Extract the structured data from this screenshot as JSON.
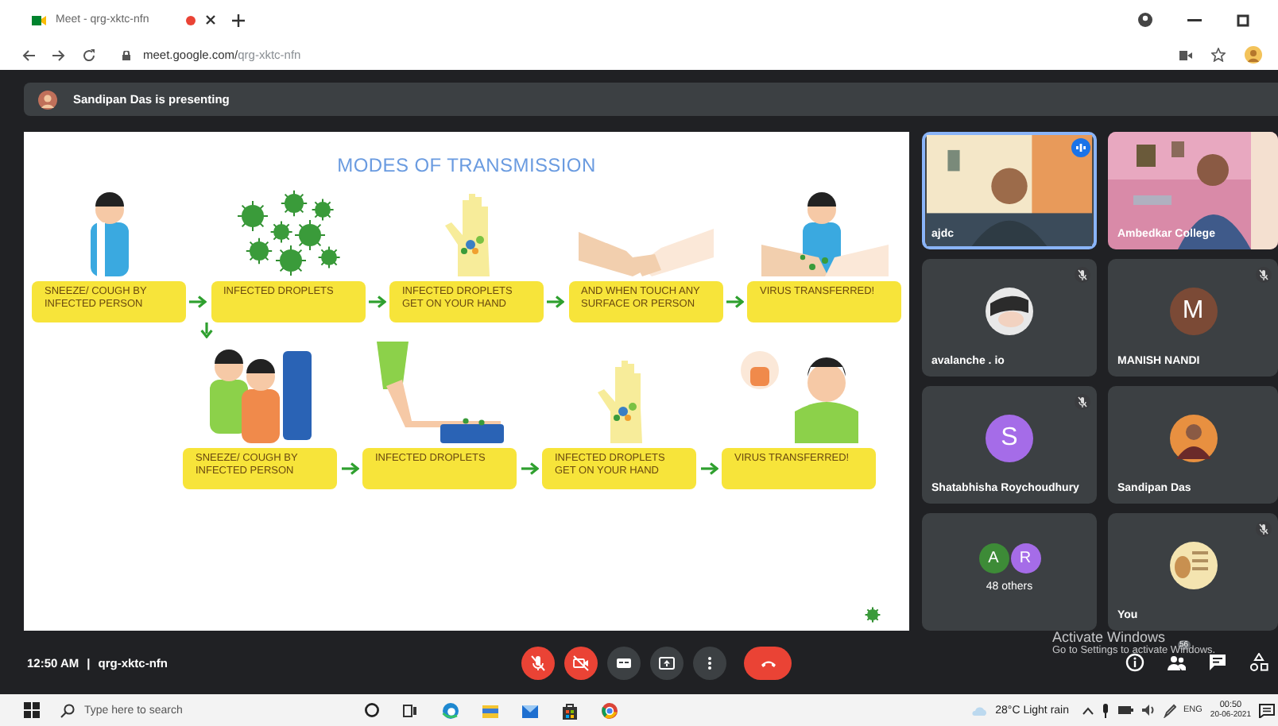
{
  "browser": {
    "tab_title": "Meet - qrg-xktc-nfn",
    "recording": true,
    "url_host": "meet.google.com/",
    "url_path": "qrg-xktc-nfn"
  },
  "presenting": {
    "text": "Sandipan Das is presenting"
  },
  "slide": {
    "title": "MODES OF TRANSMISSION",
    "rows": [
      {
        "steps": [
          {
            "kind": "sneezing-person",
            "label": "SNEEZE/ COUGH BY INFECTED PERSON"
          },
          {
            "kind": "virus-cluster",
            "label": "INFECTED DROPLETS"
          },
          {
            "kind": "hand",
            "label": "INFECTED DROPLETS GET ON YOUR HAND"
          },
          {
            "kind": "handshake",
            "label": "AND WHEN TOUCH ANY SURFACE OR PERSON"
          },
          {
            "kind": "scared-person",
            "label": "VIRUS TRANSFERRED!"
          }
        ]
      },
      {
        "steps": [
          {
            "kind": "coughing-couple",
            "label": "SNEEZE/ COUGH BY INFECTED PERSON"
          },
          {
            "kind": "arm-on-seat",
            "label": "INFECTED DROPLETS"
          },
          {
            "kind": "hand",
            "label": "INFECTED DROPLETS GET ON YOUR HAND"
          },
          {
            "kind": "sick-person",
            "label": "VIRUS TRANSFERRED!"
          }
        ]
      }
    ]
  },
  "tiles": [
    {
      "kind": "video",
      "name": "ajdc",
      "speaking": true,
      "muted": false
    },
    {
      "kind": "video",
      "name": "Ambedkar College",
      "speaking": false,
      "muted": false
    },
    {
      "name": "avalanche . io",
      "speaking": false,
      "muted": true
    },
    {
      "kind": "letter",
      "letter": "M",
      "color": "#7b4a36",
      "name": "MANISH NANDI",
      "speaking": false,
      "muted": true
    },
    {
      "kind": "letter",
      "letter": "S",
      "color": "#a56ce8",
      "name": "Shatabhisha Roychoudhury",
      "speaking": false,
      "muted": true
    },
    {
      "name": "Sandipan Das",
      "speaking": false,
      "muted": false
    },
    {
      "kind": "others",
      "avatars": [
        {
          "letter": "A",
          "color": "#3d8b37"
        },
        {
          "letter": "R",
          "color": "#a56ce8"
        }
      ],
      "name": "48 others",
      "speaking": false,
      "muted": false
    },
    {
      "name": "You",
      "speaking": false,
      "muted": true
    }
  ],
  "meeting": {
    "time": "12:50 AM",
    "separator": "|",
    "code": "qrg-xktc-nfn"
  },
  "controls": [
    {
      "kind": "mic",
      "off": true
    },
    {
      "kind": "camera",
      "off": true
    },
    {
      "kind": "captions"
    },
    {
      "kind": "present"
    },
    {
      "kind": "more"
    },
    {
      "kind": "hangup"
    }
  ],
  "side_controls": [
    {
      "kind": "info"
    },
    {
      "kind": "people",
      "badge": "56"
    },
    {
      "kind": "chat"
    },
    {
      "kind": "activities"
    }
  ],
  "activation": {
    "title": "Activate Windows",
    "subtitle": "Go to Settings to activate Windows."
  },
  "taskbar": {
    "search_placeholder": "Type here to search",
    "weather": "28°C  Light rain",
    "language": "ENG",
    "time": "00:50",
    "date": "20-06-2021"
  }
}
